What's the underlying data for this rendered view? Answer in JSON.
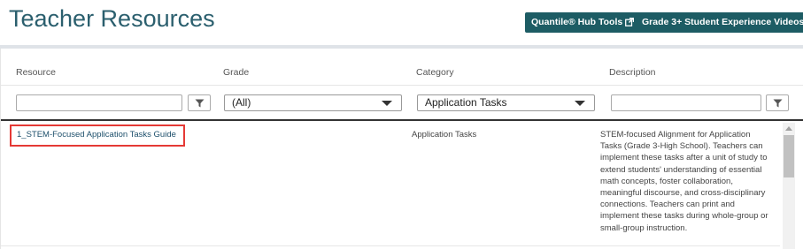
{
  "header": {
    "title": "Teacher Resources",
    "buttons": [
      {
        "label": "Quantile® Hub Tools",
        "icon": "external-link-icon"
      },
      {
        "label": "Grade 3+ Student Experience Videos",
        "icon": "external-link-icon"
      }
    ]
  },
  "grid": {
    "columns": [
      "Resource",
      "Grade",
      "Category",
      "Description"
    ],
    "filters": {
      "resource": {
        "value": ""
      },
      "grade": {
        "selected": "(All)"
      },
      "category": {
        "selected": "Application Tasks"
      },
      "description": {
        "value": ""
      }
    },
    "rows": [
      {
        "resource": "1_STEM-Focused Application Tasks Guide",
        "grade": "",
        "category": "Application Tasks",
        "description_lines": [
          "STEM-focused Alignment for Application",
          "Tasks (Grade 3-High School). Teachers can",
          "implement these tasks after a unit of study to",
          "extend students' understanding of essential",
          "math concepts, foster collaboration,",
          "meaningful discourse, and cross-disciplinary",
          "connections. Teachers can print and",
          "implement these tasks during whole-group or",
          "small-group instruction."
        ]
      }
    ]
  },
  "colors": {
    "accent": "#1d5c64",
    "title": "#2b5f6e",
    "highlight": "#e53935"
  }
}
